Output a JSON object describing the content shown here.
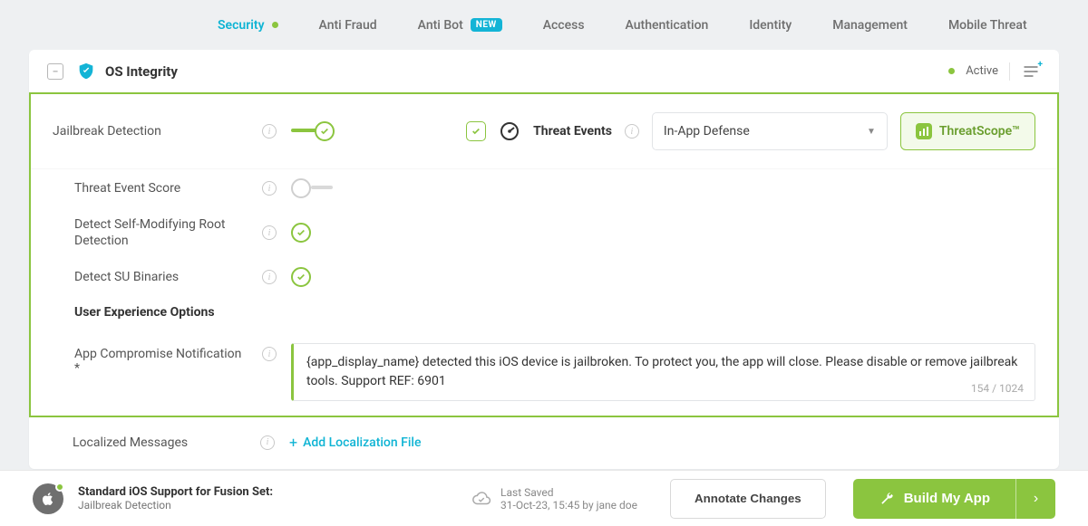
{
  "topnav": {
    "tabs": [
      {
        "label": "Security",
        "active": true,
        "dot": true
      },
      {
        "label": "Anti Fraud"
      },
      {
        "label": "Anti Bot",
        "badge": "NEW"
      },
      {
        "label": "Access"
      },
      {
        "label": "Authentication"
      },
      {
        "label": "Identity"
      },
      {
        "label": "Management"
      },
      {
        "label": "Mobile Threat"
      }
    ]
  },
  "panel": {
    "title": "OS Integrity",
    "status": "Active"
  },
  "rows": {
    "jailbreak": "Jailbreak Detection",
    "threat_events": "Threat Events",
    "defense_select": "In-App Defense",
    "threatscope": "ThreatScope™",
    "threat_score": "Threat Event Score",
    "self_mod": "Detect Self-Modifying Root Detection",
    "su_bin": "Detect SU Binaries",
    "ux_heading": "User Experience Options",
    "app_notif": "App Compromise Notification  *",
    "app_notif_text": "{app_display_name} detected this iOS device is jailbroken. To protect you, the app will close. Please disable or remove jailbreak tools. Support REF: 6901",
    "char_count": "154 / 1024",
    "localized": "Localized Messages",
    "add_loc": "Add Localization File"
  },
  "footer": {
    "line1": "Standard iOS Support for Fusion Set:",
    "line2": "Jailbreak Detection",
    "last_saved_label": "Last Saved",
    "last_saved_value": "31-Oct-23, 15:45 by jane doe",
    "annotate": "Annotate Changes",
    "build": "Build My App"
  }
}
